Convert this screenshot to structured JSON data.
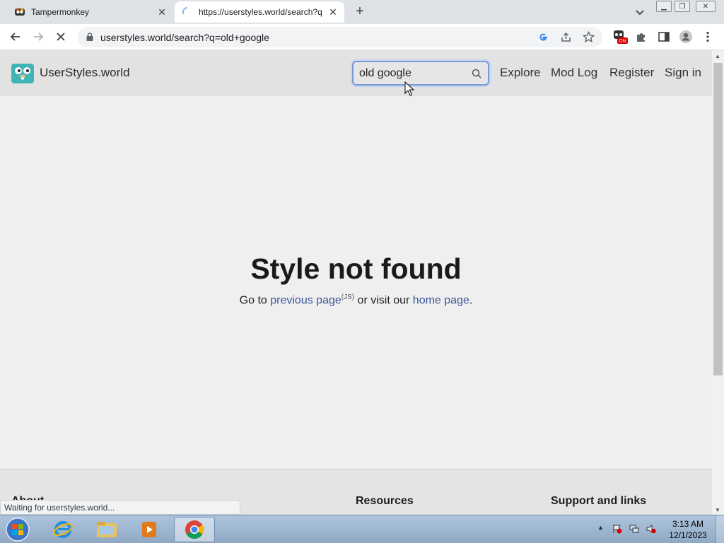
{
  "browser": {
    "tabs": [
      {
        "title": "Tampermonkey"
      },
      {
        "title": "https://userstyles.world/search?q=old+google"
      }
    ],
    "address": "userstyles.world/search?q=old+google",
    "status_text": "Waiting for userstyles.world...",
    "extension_badge": "ON"
  },
  "site": {
    "brand": "UserStyles.world",
    "search_value": "old google",
    "nav": [
      "Explore",
      "Mod Log",
      "Register",
      "Sign in"
    ]
  },
  "main": {
    "title": "Style not found",
    "go_to": "Go to ",
    "previous_link": "previous page",
    "js_note": "(JS)",
    "or_visit": " or visit our ",
    "home_link": "home page",
    "period": "."
  },
  "footer": {
    "headings": [
      "About",
      "Resources",
      "Support and links"
    ]
  },
  "taskbar": {
    "time": "3:13 AM",
    "date": "12/1/2023"
  },
  "colors": {
    "link": "#3a5599",
    "search_focus": "#7b9ad4"
  }
}
